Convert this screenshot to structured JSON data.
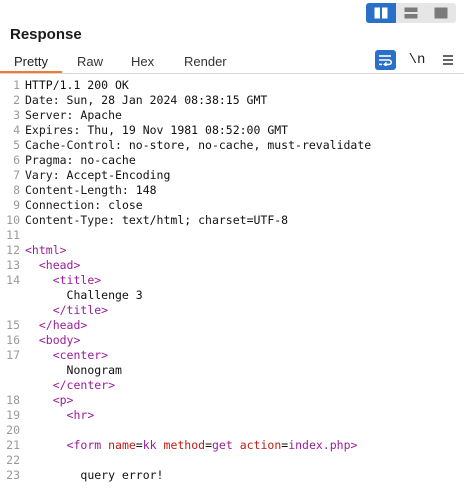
{
  "layout_toggle": {
    "options": [
      "side-by-side",
      "stacked",
      "single"
    ],
    "active": "side-by-side"
  },
  "panel": {
    "title": "Response"
  },
  "tabs": [
    {
      "label": "Pretty"
    },
    {
      "label": "Raw"
    },
    {
      "label": "Hex"
    },
    {
      "label": "Render"
    }
  ],
  "tools": {
    "newline_label": "\\n"
  },
  "colors": {
    "accent_orange": "#ef7d2e",
    "accent_blue": "#2a6fc8",
    "tag_purple": "#9b1c9b",
    "attr_red": "#c41a16"
  },
  "lines": [
    {
      "n": "1",
      "indent": "",
      "parts": [
        {
          "t": "HTTP/1.1 200 OK",
          "c": "plain"
        }
      ]
    },
    {
      "n": "2",
      "indent": "",
      "parts": [
        {
          "t": "Date:",
          "c": "key"
        },
        {
          "t": " Sun, 28 Jan 2024 08:38:15 GMT",
          "c": "plain"
        }
      ]
    },
    {
      "n": "3",
      "indent": "",
      "parts": [
        {
          "t": "Server:",
          "c": "key"
        },
        {
          "t": " Apache",
          "c": "plain"
        }
      ]
    },
    {
      "n": "4",
      "indent": "",
      "parts": [
        {
          "t": "Expires:",
          "c": "key"
        },
        {
          "t": " Thu, 19 Nov 1981 08:52:00 GMT",
          "c": "plain"
        }
      ]
    },
    {
      "n": "5",
      "indent": "",
      "parts": [
        {
          "t": "Cache-Control:",
          "c": "key"
        },
        {
          "t": " no-store, no-cache, must-revalidate",
          "c": "plain"
        }
      ]
    },
    {
      "n": "6",
      "indent": "",
      "parts": [
        {
          "t": "Pragma:",
          "c": "key"
        },
        {
          "t": " no-cache",
          "c": "plain"
        }
      ]
    },
    {
      "n": "7",
      "indent": "",
      "parts": [
        {
          "t": "Vary:",
          "c": "key"
        },
        {
          "t": " Accept-Encoding",
          "c": "plain"
        }
      ]
    },
    {
      "n": "8",
      "indent": "",
      "parts": [
        {
          "t": "Content-Length:",
          "c": "key"
        },
        {
          "t": " 148",
          "c": "plain"
        }
      ]
    },
    {
      "n": "9",
      "indent": "",
      "parts": [
        {
          "t": "Connection:",
          "c": "key"
        },
        {
          "t": " close",
          "c": "plain"
        }
      ]
    },
    {
      "n": "10",
      "indent": "",
      "parts": [
        {
          "t": "Content-Type:",
          "c": "key"
        },
        {
          "t": " text/html; charset=UTF-8",
          "c": "plain"
        }
      ]
    },
    {
      "n": "11",
      "indent": "",
      "parts": []
    },
    {
      "n": "12",
      "indent": "",
      "parts": [
        {
          "t": "<html>",
          "c": "tag"
        }
      ]
    },
    {
      "n": "13",
      "indent": "  ",
      "parts": [
        {
          "t": "<head>",
          "c": "tag"
        }
      ]
    },
    {
      "n": "14",
      "indent": "    ",
      "parts": [
        {
          "t": "<title>",
          "c": "tag"
        }
      ]
    },
    {
      "n": "",
      "indent": "      ",
      "parts": [
        {
          "t": "Challenge 3",
          "c": "plain"
        }
      ]
    },
    {
      "n": "",
      "indent": "    ",
      "parts": [
        {
          "t": "</title>",
          "c": "tag"
        }
      ]
    },
    {
      "n": "15",
      "indent": "  ",
      "parts": [
        {
          "t": "</head>",
          "c": "tag"
        }
      ]
    },
    {
      "n": "16",
      "indent": "  ",
      "parts": [
        {
          "t": "<body>",
          "c": "tag"
        }
      ]
    },
    {
      "n": "17",
      "indent": "    ",
      "parts": [
        {
          "t": "<center>",
          "c": "tag"
        }
      ]
    },
    {
      "n": "",
      "indent": "      ",
      "parts": [
        {
          "t": "Nonogram",
          "c": "plain"
        }
      ]
    },
    {
      "n": "",
      "indent": "    ",
      "parts": [
        {
          "t": "</center>",
          "c": "tag"
        }
      ]
    },
    {
      "n": "18",
      "indent": "    ",
      "parts": [
        {
          "t": "<p>",
          "c": "tag"
        }
      ]
    },
    {
      "n": "19",
      "indent": "      ",
      "parts": [
        {
          "t": "<hr>",
          "c": "tag"
        }
      ]
    },
    {
      "n": "20",
      "indent": "",
      "parts": []
    },
    {
      "n": "21",
      "indent": "      ",
      "parts": [
        {
          "t": "<form ",
          "c": "tag"
        },
        {
          "t": "name",
          "c": "attr"
        },
        {
          "t": "=",
          "c": "plain"
        },
        {
          "t": "kk",
          "c": "val"
        },
        {
          "t": " method",
          "c": "attr"
        },
        {
          "t": "=",
          "c": "plain"
        },
        {
          "t": "get",
          "c": "val"
        },
        {
          "t": " action",
          "c": "attr"
        },
        {
          "t": "=",
          "c": "plain"
        },
        {
          "t": "index.php",
          "c": "val"
        },
        {
          "t": ">",
          "c": "tag"
        }
      ]
    },
    {
      "n": "22",
      "indent": "",
      "parts": []
    },
    {
      "n": "23",
      "indent": "        ",
      "parts": [
        {
          "t": "query error!",
          "c": "plain"
        }
      ]
    }
  ]
}
